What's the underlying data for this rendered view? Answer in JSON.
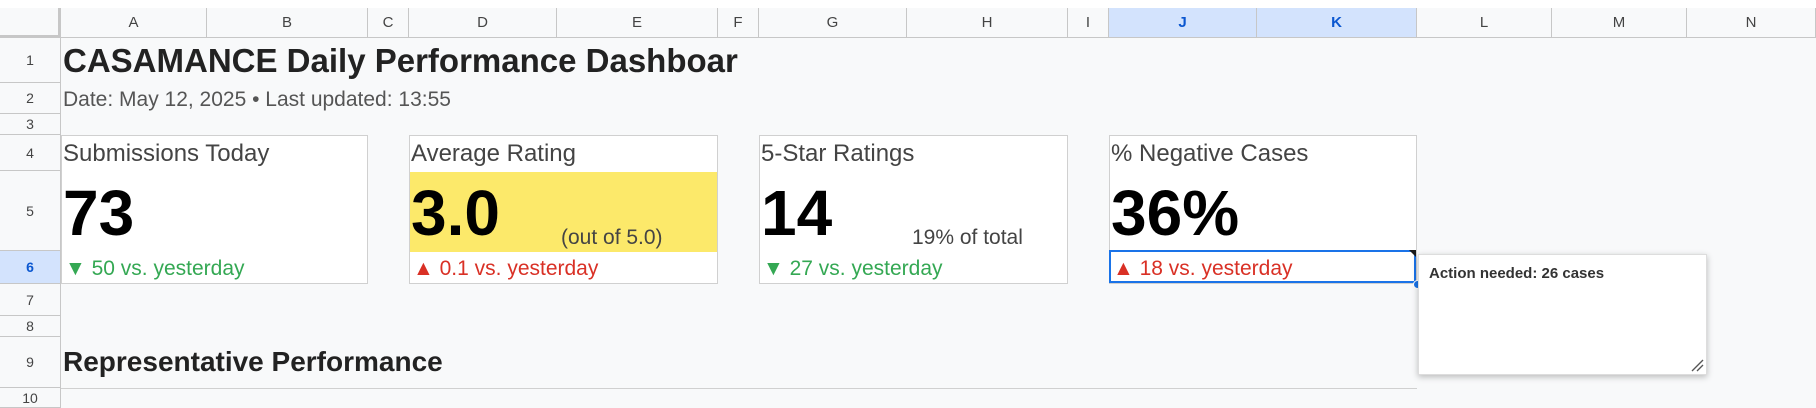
{
  "columns": [
    "A",
    "B",
    "C",
    "D",
    "E",
    "F",
    "G",
    "H",
    "I",
    "J",
    "K",
    "L",
    "M",
    "N"
  ],
  "rows": [
    "1",
    "2",
    "3",
    "4",
    "5",
    "6",
    "7",
    "8",
    "9",
    "10"
  ],
  "selected_columns": [
    "J",
    "K"
  ],
  "selected_row": "6",
  "sheet": {
    "title": "CASAMANCE Daily Performance Dashboar",
    "subtitle": "Date: May 12, 2025 • Last updated: 13:55",
    "section_title": "Representative Performance"
  },
  "cards": [
    {
      "label": "Submissions Today",
      "value": "73",
      "sub": "",
      "delta": "▼ 50 vs. yesterday",
      "delta_color": "#34a853",
      "highlight": false
    },
    {
      "label": "Average Rating",
      "value": "3.0",
      "sub": "(out of 5.0)",
      "delta": "▲ 0.1 vs. yesterday",
      "delta_color": "#d93025",
      "highlight": true,
      "highlight_color": "#fce96a"
    },
    {
      "label": "5-Star Ratings",
      "value": "14",
      "sub": "19% of total",
      "delta": "▼ 27 vs. yesterday",
      "delta_color": "#34a853",
      "highlight": false
    },
    {
      "label": "% Negative Cases",
      "value": "36%",
      "sub": "",
      "delta": "▲ 18 vs. yesterday",
      "delta_color": "#d93025",
      "highlight": false
    }
  ],
  "note": {
    "text": "Action needed: 26 cases"
  },
  "colors": {
    "selection": "#1a73e8",
    "header_selected_bg": "#d3e3fd",
    "header_selected_text": "#0b57d0"
  }
}
